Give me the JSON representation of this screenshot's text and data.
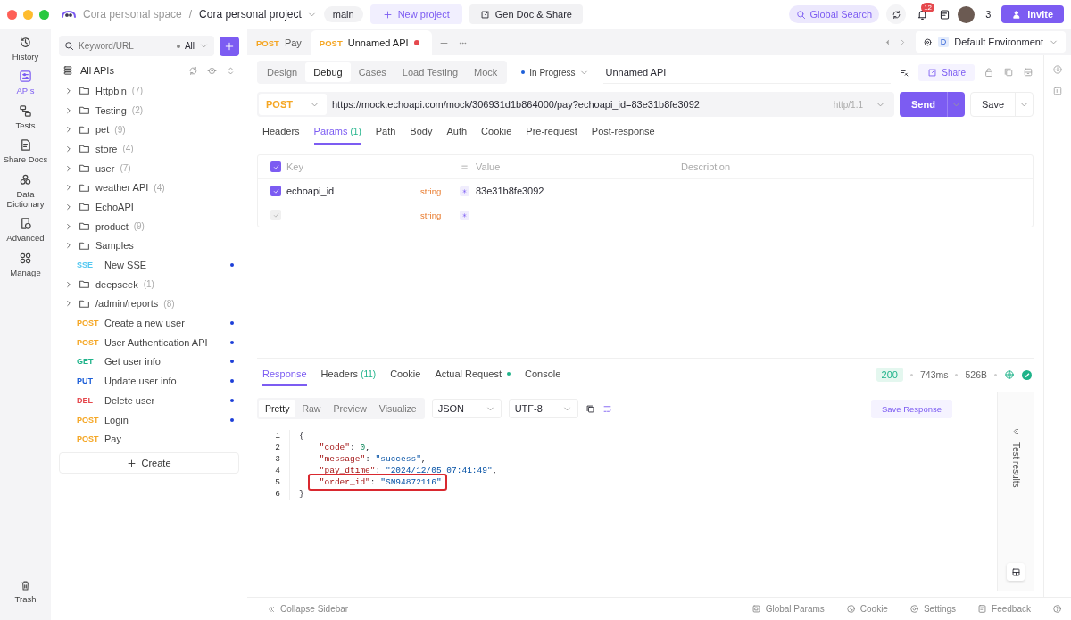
{
  "titlebar": {
    "workspace": "Cora personal space",
    "separator": "/",
    "project": "Cora personal project",
    "branch": "main",
    "new_project": "New project",
    "gen_doc": "Gen Doc & Share",
    "global_search": "Global Search",
    "notifications": "12",
    "members": "3",
    "invite": "Invite"
  },
  "rail": {
    "items": [
      {
        "label": "History",
        "selected": false
      },
      {
        "label": "APIs",
        "selected": true
      },
      {
        "label": "Tests",
        "selected": false
      },
      {
        "label": "Share Docs",
        "selected": false
      },
      {
        "label": "Data Dictionary",
        "selected": false
      },
      {
        "label": "Advanced",
        "selected": false
      },
      {
        "label": "Manage",
        "selected": false
      }
    ],
    "trash": "Trash"
  },
  "sidebar": {
    "search_placeholder": "Keyword/URL",
    "filter": "All",
    "all_apis": "All APIs",
    "items": [
      {
        "kind": "folder",
        "name": "Httpbin",
        "count": "(7)"
      },
      {
        "kind": "folder",
        "name": "Testing",
        "count": "(2)"
      },
      {
        "kind": "folder",
        "name": "pet",
        "count": "(9)"
      },
      {
        "kind": "folder",
        "name": "store",
        "count": "(4)"
      },
      {
        "kind": "folder",
        "name": "user",
        "count": "(7)"
      },
      {
        "kind": "folder",
        "name": "weather API",
        "count": "(4)"
      },
      {
        "kind": "folder",
        "name": "EchoAPI"
      },
      {
        "kind": "folder",
        "name": "product",
        "count": "(9)"
      },
      {
        "kind": "folder",
        "name": "Samples"
      },
      {
        "kind": "api",
        "method": "SSE",
        "name": "New SSE",
        "dot": true
      },
      {
        "kind": "folder",
        "name": "deepseek",
        "count": "(1)"
      },
      {
        "kind": "folder",
        "name": "/admin/reports",
        "count": "(8)"
      },
      {
        "kind": "api",
        "method": "POST",
        "name": "Create a new user",
        "dot": true
      },
      {
        "kind": "api",
        "method": "POST",
        "name": "User Authentication API",
        "dot": true
      },
      {
        "kind": "api",
        "method": "GET",
        "name": "Get user info",
        "dot": true
      },
      {
        "kind": "api",
        "method": "PUT",
        "name": "Update user info",
        "dot": true
      },
      {
        "kind": "api",
        "method": "DEL",
        "name": "Delete user",
        "dot": true
      },
      {
        "kind": "api",
        "method": "POST",
        "name": "Login",
        "dot": true
      },
      {
        "kind": "api",
        "method": "POST",
        "name": "Pay",
        "dot": false
      }
    ],
    "create": "Create"
  },
  "tabs": [
    {
      "method": "POST",
      "name": "Pay",
      "selected": false,
      "modified": false
    },
    {
      "method": "POST",
      "name": "Unnamed API",
      "selected": true,
      "modified": true
    }
  ],
  "environment": {
    "badge": "D",
    "name": "Default Environment"
  },
  "mode_tabs": [
    {
      "label": "Design",
      "selected": false
    },
    {
      "label": "Debug",
      "selected": true
    },
    {
      "label": "Cases",
      "selected": false
    },
    {
      "label": "Load Testing",
      "selected": false
    },
    {
      "label": "Mock",
      "selected": false
    }
  ],
  "status": "In Progress",
  "api_name": "Unnamed API",
  "share": "Share",
  "request": {
    "method": "POST",
    "url": "https://mock.echoapi.com/mock/306931d1b864000/pay?echoapi_id=83e31b8fe3092",
    "protocol": "http/1.1",
    "send": "Send",
    "save": "Save"
  },
  "request_tabs": [
    {
      "label": "Headers",
      "selected": false
    },
    {
      "label": "Params",
      "count": "(1)",
      "selected": true
    },
    {
      "label": "Path",
      "selected": false
    },
    {
      "label": "Body",
      "selected": false
    },
    {
      "label": "Auth",
      "selected": false
    },
    {
      "label": "Cookie",
      "selected": false
    },
    {
      "label": "Pre-request",
      "selected": false
    },
    {
      "label": "Post-response",
      "selected": false
    }
  ],
  "params": {
    "columns": [
      "Key",
      "Value",
      "Description"
    ],
    "header_checked": true,
    "rows": [
      {
        "checked": true,
        "key": "echoapi_id",
        "type": "string",
        "value": "83e31b8fe3092"
      },
      {
        "checked": false,
        "type": "string"
      }
    ]
  },
  "response_tabs": [
    {
      "label": "Response",
      "selected": true
    },
    {
      "label": "Headers",
      "count": "(11)",
      "selected": false
    },
    {
      "label": "Cookie",
      "selected": false
    },
    {
      "label": "Actual Request",
      "dot": true,
      "selected": false
    },
    {
      "label": "Console",
      "selected": false
    }
  ],
  "response_status": {
    "code": "200",
    "time": "743ms",
    "size": "526B"
  },
  "view_tabs": [
    {
      "label": "Pretty",
      "selected": true
    },
    {
      "label": "Raw",
      "selected": false
    },
    {
      "label": "Preview",
      "selected": false
    },
    {
      "label": "Visualize",
      "selected": false
    }
  ],
  "format": "JSON",
  "encoding": "UTF-8",
  "save_response": "Save Response",
  "code": [
    {
      "number": "1",
      "text": "{",
      "highlighted": false
    },
    {
      "number": "2",
      "text": "    \"code\": 0,",
      "highlighted": false
    },
    {
      "number": "3",
      "text": "    \"message\": \"success\",",
      "highlighted": false
    },
    {
      "number": "4",
      "text": "    \"pay_dtime\": \"2024/12/05 07:41:49\",",
      "highlighted": false
    },
    {
      "number": "5",
      "text": "    \"order_id\": \"SN94872116\"",
      "highlighted": true
    },
    {
      "number": "6",
      "text": "}",
      "highlighted": false
    }
  ],
  "test_results": "Test results",
  "footer": {
    "collapse": "Collapse Sidebar",
    "links": [
      "Global Params",
      "Cookie",
      "Settings",
      "Feedback"
    ]
  }
}
